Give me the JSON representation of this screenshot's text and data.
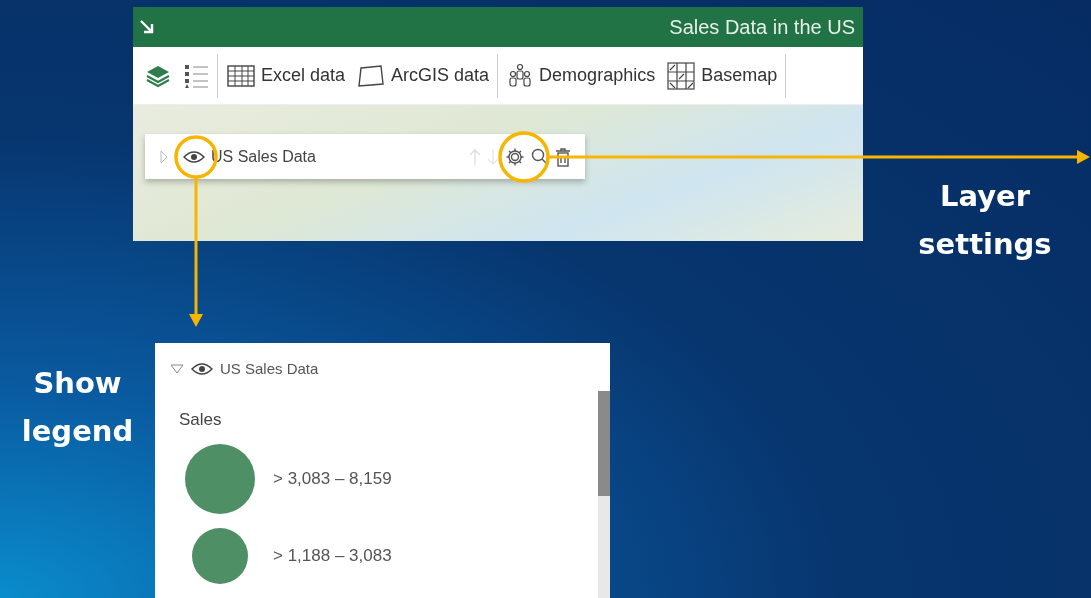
{
  "map_panel": {
    "title": "Sales Data in the US",
    "toolbar": [
      {
        "kind": "layers",
        "separator_after": false
      },
      {
        "kind": "legend",
        "separator_after": true
      },
      {
        "kind": "table",
        "label": "Excel data",
        "separator_after": false
      },
      {
        "kind": "shape",
        "label": "ArcGIS data",
        "separator_after": true
      },
      {
        "kind": "people",
        "label": "Demographics",
        "separator_after": false
      },
      {
        "kind": "grid",
        "label": "Basemap",
        "separator_after": true
      }
    ],
    "layer_row": {
      "name": "US Sales Data",
      "expanded": false,
      "visible": true
    }
  },
  "legend_panel": {
    "layer": {
      "name": "US Sales Data",
      "expanded": true,
      "visible": true
    },
    "title": "Sales",
    "classes": [
      {
        "label": "> 3,083 – 8,159",
        "kind": "large"
      },
      {
        "label": "> 1,188 – 3,083",
        "kind": "medium"
      }
    ]
  },
  "callouts": [
    {
      "kind": "settings",
      "label": "Layer settings"
    },
    {
      "kind": "legend",
      "label": "Show legend"
    }
  ]
}
